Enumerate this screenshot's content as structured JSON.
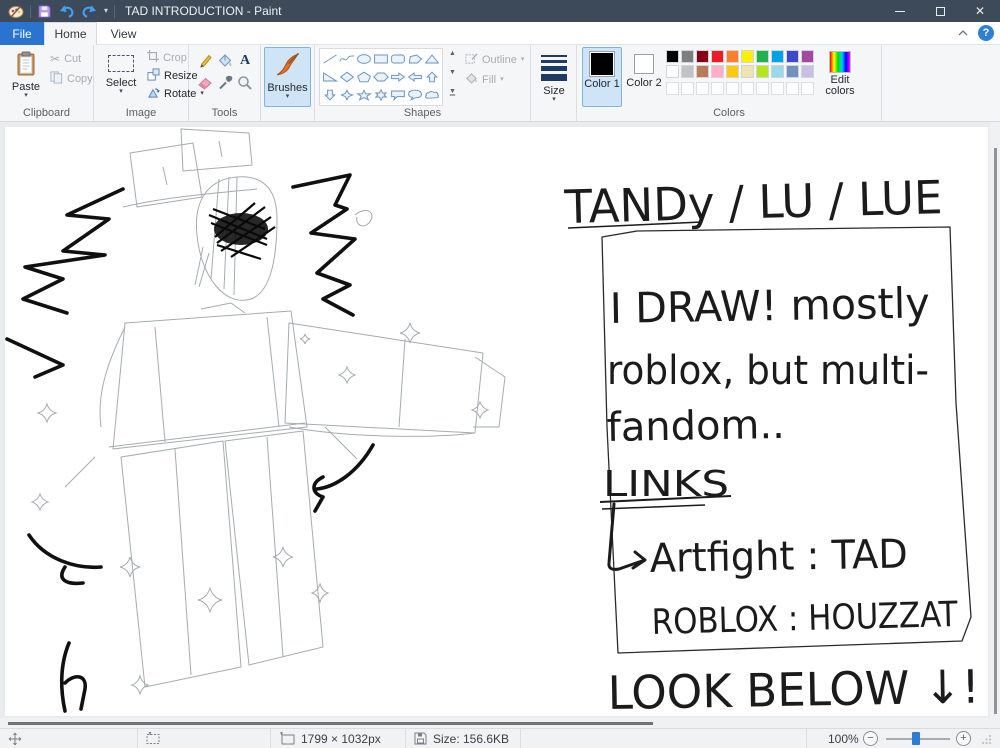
{
  "window": {
    "title": "TAD INTRODUCTION - Paint"
  },
  "titlebar": {
    "quick_access_icons": [
      "paint-logo",
      "save",
      "undo",
      "redo",
      "customize-caret"
    ],
    "controls": [
      "minimize",
      "maximize",
      "close"
    ]
  },
  "ribbon_tabs": {
    "file": "File",
    "home": "Home",
    "view": "View",
    "active": "Home"
  },
  "ribbon": {
    "clipboard": {
      "label": "Clipboard",
      "paste": "Paste",
      "cut": "Cut",
      "copy": "Copy"
    },
    "image": {
      "label": "Image",
      "select": "Select",
      "crop": "Crop",
      "resize": "Resize",
      "rotate": "Rotate"
    },
    "tools": {
      "label": "Tools",
      "tool_names": [
        "pencil",
        "fill-with-color",
        "text",
        "eraser",
        "color-picker",
        "magnifier"
      ]
    },
    "brushes": {
      "label": "Brushes",
      "selected": true
    },
    "shapes": {
      "label": "Shapes",
      "outline": "Outline",
      "fill": "Fill",
      "shape_names": [
        "line",
        "curve",
        "oval",
        "rectangle",
        "rounded-rectangle",
        "polygon",
        "triangle",
        "right-triangle",
        "diamond",
        "pentagon",
        "hexagon",
        "right-arrow",
        "left-arrow",
        "up-arrow",
        "down-arrow",
        "four-point-star",
        "five-point-star",
        "six-point-star",
        "rounded-callout",
        "oval-callout",
        "cloud-callout"
      ]
    },
    "size": {
      "label": "Size"
    },
    "colors": {
      "label": "Colors",
      "color1": "Color 1",
      "color2": "Color 2",
      "edit": "Edit colors",
      "active_color1": "#000000",
      "active_color2": "#ffffff",
      "palette_row1": [
        "#000000",
        "#7f7f7f",
        "#880015",
        "#ed1c24",
        "#ff7f27",
        "#fff200",
        "#22b14c",
        "#00a2e8",
        "#3f48cc",
        "#a349a4"
      ],
      "palette_row2": [
        "#ffffff",
        "#c3c3c3",
        "#b97a57",
        "#ffaec9",
        "#ffc90e",
        "#efe4b0",
        "#b5e61d",
        "#99d9ea",
        "#7092be",
        "#c8bfe7"
      ],
      "empty_slots": 10
    }
  },
  "canvas": {
    "drawing_description": "hand-drawn pencil sketch of a Roblox-style blocky character with spiky black hair, scribbled face, top-hat blocks and sparkle stars",
    "texts": {
      "name": "TANDy / LU / LUE",
      "line1": "I DRAW! mostly",
      "line2": "roblox, but multi-",
      "line3": "fandom..",
      "links_heading": "LINKS",
      "link1": "Artfight : TAD",
      "link2": "ROBLOX : HOUZZAT",
      "footer": "LOOK BELOW ↓!"
    }
  },
  "statusbar": {
    "canvas_size": "1799 × 1032px",
    "file_size": "Size: 156.6KB",
    "zoom_level": "100%"
  }
}
